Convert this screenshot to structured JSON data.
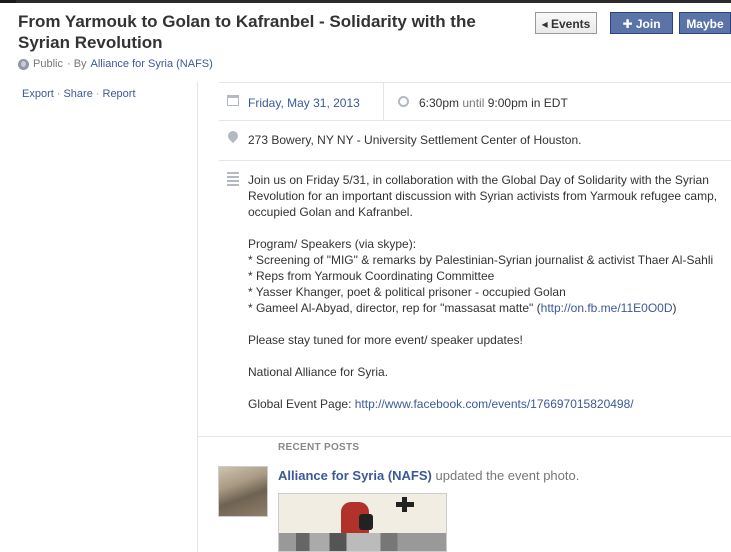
{
  "event": {
    "title": "From Yarmouk to Golan to Kafranbel - Solidarity with the Syrian Revolution",
    "privacy": "Public",
    "by_label": "· By",
    "host": "Alliance for Syria (NAFS)"
  },
  "buttons": {
    "events": "Events",
    "join": "Join",
    "maybe": "Maybe"
  },
  "side_links": [
    "Export",
    "Share",
    "Report"
  ],
  "details": {
    "date": "Friday, May 31, 2013",
    "start_time": "6:30pm",
    "until_label": "until",
    "end_time": "9:00pm",
    "tz_label": "in EDT",
    "address": "273 Bowery, NY NY - University Settlement Center of Houston.",
    "description_intro": "Join us on Friday 5/31, in collaboration with the Global Day of Solidarity with the Syrian Revolution for an important discussion with Syrian activists from Yarmouk refugee camp, occupied Golan and Kafranbel.",
    "program_heading": "Program/ Speakers (via skype):",
    "program_items": [
      "* Screening of \"MIG\" & remarks by Palestinian-Syrian journalist & activist Thaer Al-Sahli",
      "* Reps from Yarmouk Coordinating Committee",
      "* Yasser Khanger, poet & political prisoner - occupied Golan",
      "* Gameel Al-Abyad, director, rep for \"massasat matte\" ("
    ],
    "program_link": "http://on.fb.me/11E0O0D",
    "program_link_close": ")",
    "stay_tuned": "Please stay tuned for more event/ speaker updates!",
    "national": "National Alliance for Syria.",
    "global_label": "Global Event Page:",
    "global_link": "http://www.facebook.com/events/176697015820498/"
  },
  "recent_posts": {
    "heading": "RECENT POSTS",
    "author": "Alliance for Syria (NAFS)",
    "action": "updated the event photo."
  }
}
